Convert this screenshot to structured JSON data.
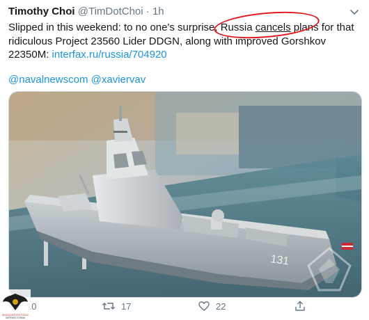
{
  "tweet": {
    "author_name": "Timothy Choi",
    "author_handle": "@TimDotChoi",
    "separator": "·",
    "time": "1h",
    "text_part1": "Slipped in this weekend: to no one's surprise, Russia ",
    "text_underlined": "cancels",
    "text_part2": " plans for that ridiculous Project 23560 Lider DDGN, along with improved Gorshkov 22350M: ",
    "link_text": "interfax.ru/russia/704920",
    "mention1": "@navalnewscom",
    "mention2": "@xaviervav",
    "hull_number": "131"
  },
  "actions": {
    "reply_count": "10",
    "retweet_count": "17",
    "like_count": "22"
  },
  "watermark": {
    "line1": "HEADQUARTERS FORCE",
    "line2": "DEFENCE FORUM"
  },
  "colors": {
    "link": "#1b95e0",
    "secondary_text": "#657786",
    "annotation_circle": "#e0161b"
  }
}
